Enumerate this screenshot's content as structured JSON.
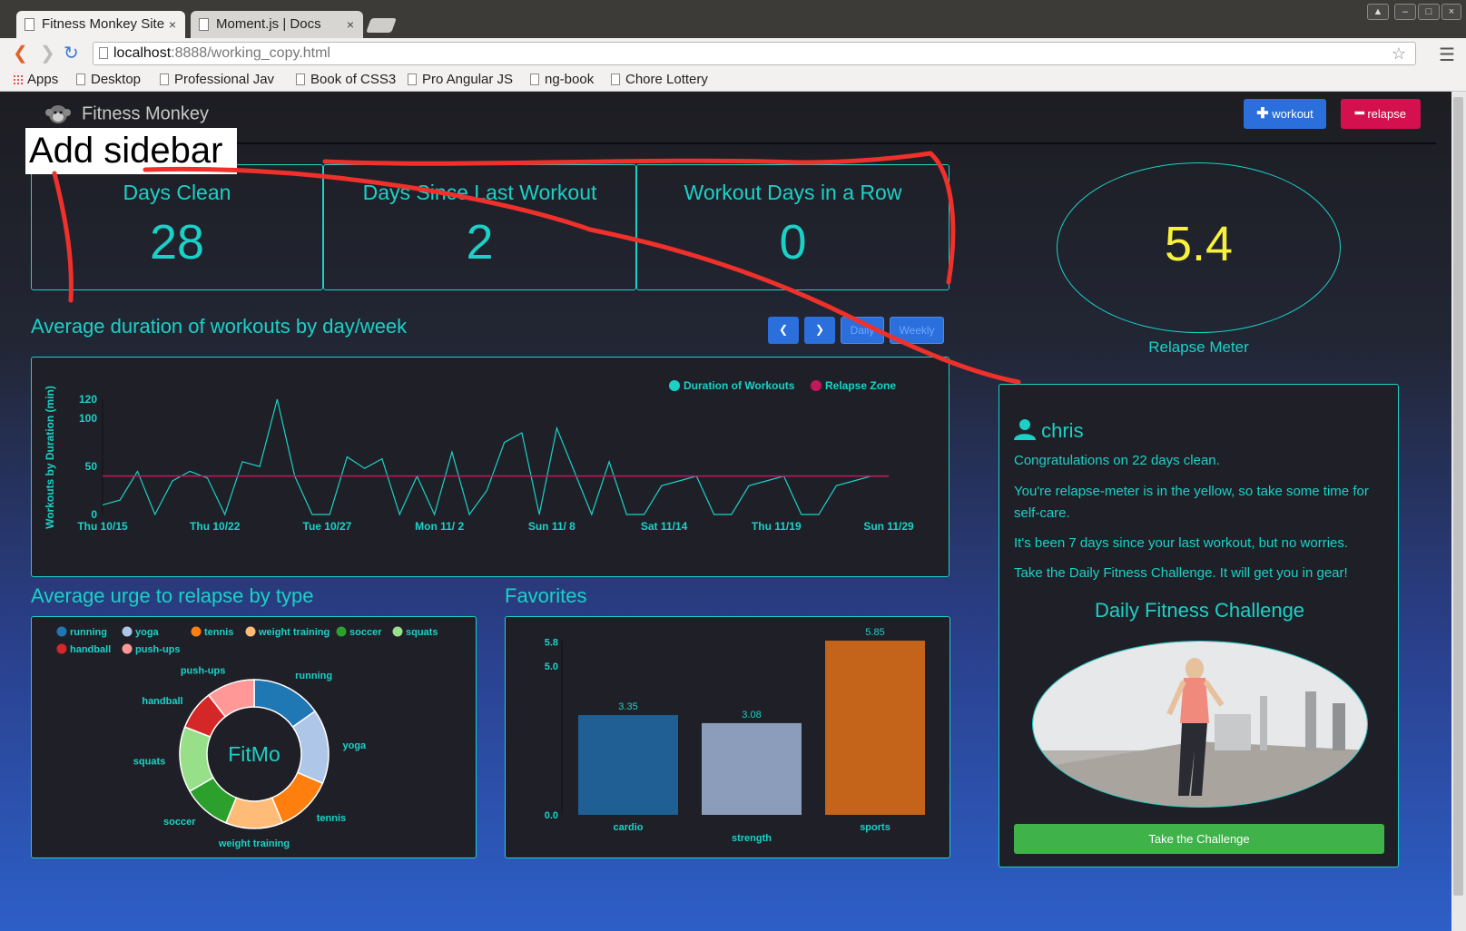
{
  "browser": {
    "tabs": [
      {
        "title": "Fitness Monkey Site",
        "close": "×"
      },
      {
        "title": "Moment.js | Docs",
        "close": "×"
      }
    ],
    "url_host": "localhost",
    "url_path": ":8888/working_copy.html",
    "bookmarks": [
      "Apps",
      "Desktop",
      "Professional Jav",
      "Book of CSS3",
      "Pro Angular JS",
      "ng-book",
      "Chore Lottery"
    ]
  },
  "header": {
    "brand": "Fitness Monkey",
    "workout_label": "workout",
    "relapse_label": "relapse"
  },
  "annotation": {
    "text": "Add sidebar"
  },
  "stats": [
    {
      "label": "Days Clean",
      "value": "28"
    },
    {
      "label": "Days Since Last Workout",
      "value": "2"
    },
    {
      "label": "Workout Days in a Row",
      "value": "0"
    }
  ],
  "meter": {
    "value": "5.4",
    "caption": "Relapse Meter"
  },
  "duration_section": {
    "title": "Average duration of workouts by day/week",
    "daily_label": "Daily",
    "weekly_label": "Weekly"
  },
  "user": {
    "name": "chris",
    "messages": [
      "Congratulations on 22 days clean.",
      "You're relapse-meter is in the yellow, so take some time for self-care.",
      "It's been 7 days since your last workout, but no worries.",
      "Take the Daily Fitness Challenge. It will get you in gear!"
    ],
    "challenge_title": "Daily Fitness Challenge",
    "challenge_button": "Take the Challenge"
  },
  "urge_section": {
    "title": "Average urge to relapse by type",
    "center_label": "FitMo"
  },
  "favorites_section": {
    "title": "Favorites"
  },
  "colors": {
    "accent": "#1bd1c7",
    "meter": "#f7f13a",
    "workout_btn": "#2a6fdc",
    "relapse_btn": "#d5104e",
    "relapse_line": "#c2185b"
  },
  "chart_data": [
    {
      "type": "line",
      "ylabel": "Workouts by Duration (min)",
      "legend": [
        "Duration of Workouts",
        "Relapse Zone"
      ],
      "xtick_labels": [
        "Thu 10/15",
        "Thu 10/22",
        "Tue 10/27",
        "Mon 11/ 2",
        "Sun 11/ 8",
        "Sat 11/14",
        "Thu 11/19",
        "Sun 11/29"
      ],
      "yticks": [
        0,
        50,
        100,
        120
      ],
      "ylim": [
        0,
        120
      ],
      "series": [
        {
          "name": "Duration of Workouts",
          "values": [
            10,
            15,
            45,
            0,
            35,
            45,
            38,
            0,
            55,
            50,
            120,
            40,
            0,
            0,
            60,
            48,
            58,
            0,
            40,
            0,
            65,
            0,
            25,
            75,
            85,
            0,
            90,
            45,
            0,
            55,
            0,
            0,
            30,
            35,
            40,
            0,
            0,
            30,
            35,
            40,
            0,
            0,
            30,
            35,
            40,
            40
          ]
        },
        {
          "name": "Relapse Zone",
          "values": [
            40,
            40
          ]
        }
      ]
    },
    {
      "type": "pie",
      "center_label": "FitMo",
      "legend": [
        "running",
        "yoga",
        "tennis",
        "weight training",
        "soccer",
        "squats",
        "handball",
        "push-ups"
      ],
      "values": [
        16,
        17,
        13,
        13,
        11,
        15,
        9,
        11
      ],
      "colors": [
        "#1f77b4",
        "#aec7e8",
        "#ff7f0e",
        "#ffbb78",
        "#2ca02c",
        "#98df8a",
        "#d62728",
        "#ff9896"
      ]
    },
    {
      "type": "bar",
      "categories": [
        "cardio",
        "strength",
        "sports"
      ],
      "values": [
        3.35,
        3.08,
        5.85
      ],
      "colors": [
        "#1f5f94",
        "#8b9dba",
        "#c4641a"
      ],
      "yticks": [
        0.0,
        5.0,
        5.8
      ],
      "ylim": [
        0,
        5.85
      ]
    }
  ]
}
